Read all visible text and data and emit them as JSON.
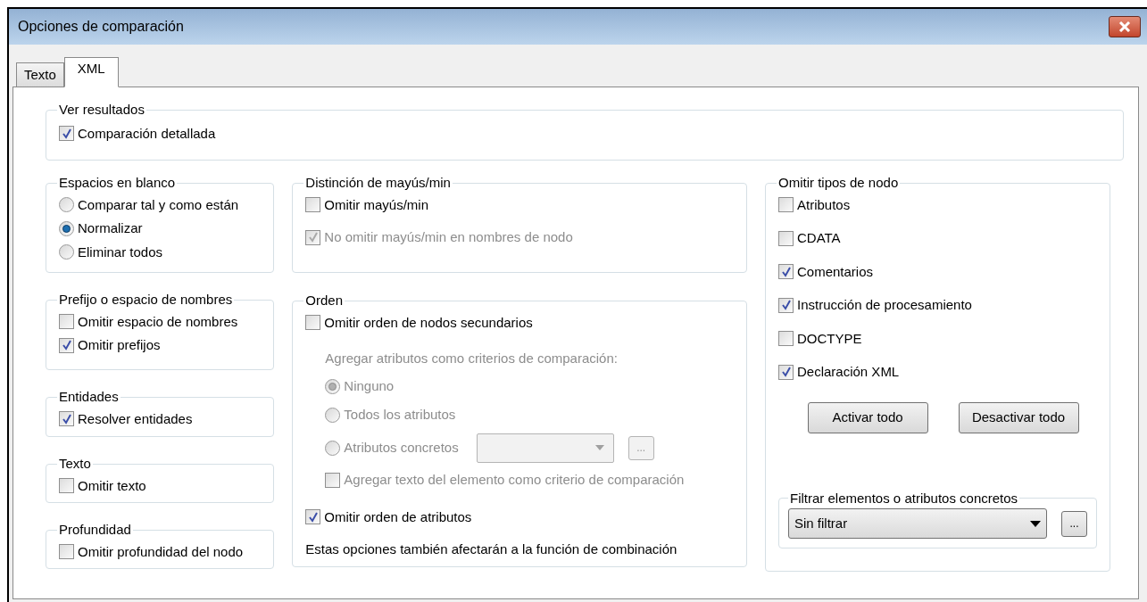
{
  "window": {
    "title": "Opciones de comparación"
  },
  "tabs": [
    {
      "label": "Texto",
      "selected": false
    },
    {
      "label": "XML",
      "selected": true
    }
  ],
  "top_group": {
    "title": "Ver resultados",
    "items": [
      {
        "kind": "checkbox",
        "label": "Comparación detallada",
        "checked": true,
        "disabled": false
      }
    ]
  },
  "columns": [
    {
      "groups": [
        {
          "title": "Espacios en blanco",
          "items": [
            {
              "kind": "radio",
              "label": "Comparar tal y como están",
              "selected": false,
              "disabled": false
            },
            {
              "kind": "radio",
              "label": "Normalizar",
              "selected": true,
              "disabled": false
            },
            {
              "kind": "radio",
              "label": "Eliminar todos",
              "selected": false,
              "disabled": false
            }
          ]
        },
        {
          "title": "Prefijo o espacio de nombres",
          "items": [
            {
              "kind": "checkbox",
              "label": "Omitir espacio de nombres",
              "checked": false,
              "disabled": false
            },
            {
              "kind": "checkbox",
              "label": "Omitir prefijos",
              "checked": true,
              "disabled": false
            }
          ]
        },
        {
          "title": "Entidades",
          "items": [
            {
              "kind": "checkbox",
              "label": "Resolver entidades",
              "checked": true,
              "disabled": false
            }
          ]
        },
        {
          "title": "Texto",
          "items": [
            {
              "kind": "checkbox",
              "label": "Omitir texto",
              "checked": false,
              "disabled": false
            }
          ]
        },
        {
          "title": "Profundidad",
          "items": [
            {
              "kind": "checkbox",
              "label": "Omitir profundidad del nodo",
              "checked": false,
              "disabled": false
            }
          ]
        }
      ]
    },
    {
      "groups": [
        {
          "title": "Distinción de mayús/min",
          "items": [
            {
              "kind": "checkbox",
              "label": "Omitir mayús/min",
              "checked": false,
              "disabled": false
            },
            {
              "kind": "checkbox",
              "label": "No omitir mayús/min en nombres de nodo",
              "checked": true,
              "disabled": true
            }
          ]
        },
        {
          "title": "Orden",
          "items": [
            {
              "kind": "checkbox",
              "label": "Omitir orden de nodos secundarios",
              "checked": false,
              "disabled": false,
              "children": [
                {
                  "kind": "note",
                  "label": "Agregar atributos como criterios de comparación:",
                  "disabled": true
                },
                {
                  "kind": "radio",
                  "label": "Ninguno",
                  "selected": true,
                  "disabled": true
                },
                {
                  "kind": "radio",
                  "label": "Todos los atributos",
                  "selected": false,
                  "disabled": true
                },
                {
                  "kind": "radio_combo",
                  "label": "Atributos concretos",
                  "selected": false,
                  "disabled": true,
                  "button": "..."
                },
                {
                  "kind": "checkbox",
                  "label": "Agregar texto del elemento como criterio de comparación",
                  "checked": false,
                  "disabled": true
                }
              ]
            },
            {
              "kind": "checkbox",
              "label": "Omitir orden de atributos",
              "checked": true,
              "disabled": false
            },
            {
              "kind": "note",
              "label": "Estas opciones también afectarán a la función de combinación",
              "disabled": false
            }
          ]
        }
      ]
    },
    {
      "groups": [
        {
          "title": "Omitir tipos de nodo",
          "items": [
            {
              "kind": "checkbox",
              "label": "Atributos",
              "checked": false,
              "disabled": false
            },
            {
              "kind": "checkbox",
              "label": "CDATA",
              "checked": false,
              "disabled": false
            },
            {
              "kind": "checkbox",
              "label": "Comentarios",
              "checked": true,
              "disabled": false
            },
            {
              "kind": "checkbox",
              "label": "Instrucción de procesamiento",
              "checked": true,
              "disabled": false
            },
            {
              "kind": "checkbox",
              "label": "DOCTYPE",
              "checked": false,
              "disabled": false
            },
            {
              "kind": "checkbox",
              "label": "Declaración XML",
              "checked": true,
              "disabled": false
            }
          ],
          "buttons": [
            "Activar todo",
            "Desactivar todo"
          ],
          "filter": {
            "title": "Filtrar elementos o atributos concretos",
            "value": "Sin filtrar",
            "button": "..."
          }
        }
      ]
    }
  ]
}
